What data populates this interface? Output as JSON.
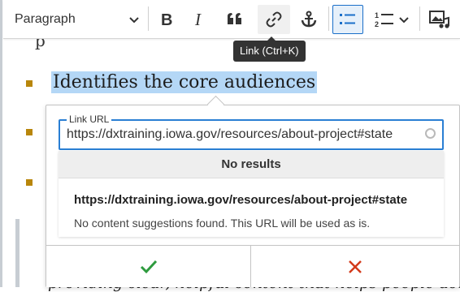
{
  "toolbar": {
    "heading_value": "Paragraph",
    "tooltip": "Link (Ctrl+K)",
    "icons": [
      "bold-icon",
      "italic-icon",
      "blockquote-icon",
      "link-icon",
      "anchor-icon",
      "bulleted-list-icon",
      "numbered-list-icon",
      "media-icon"
    ]
  },
  "content": {
    "list_items": [
      "Identifies the core audiences"
    ],
    "bottom_text": "providing clear, helpful content that helps people acc"
  },
  "link_balloon": {
    "field_label": "Link URL",
    "url_value": "https://dxtraining.iowa.gov/resources/about-project#state",
    "results_header": "No results",
    "result_url": "https://dxtraining.iowa.gov/resources/about-project#state",
    "result_desc": "No content suggestions found. This URL will be used as is."
  },
  "colors": {
    "accent": "#2a7fd4",
    "bullet": "#b8860b",
    "save": "#2e9b3e",
    "cancel": "#d33a1a",
    "selection": "#b4d7f6"
  }
}
